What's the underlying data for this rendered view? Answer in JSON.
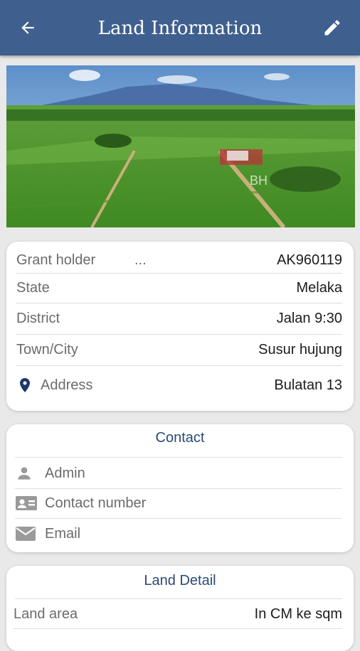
{
  "header": {
    "title": "Land Information",
    "back_icon": "arrow-left-icon",
    "edit_icon": "pencil-icon"
  },
  "hero_image": {
    "watermark": "BH"
  },
  "land_info": {
    "grant_holder_label": "Grant holder",
    "grant_holder_ellipsis": "...",
    "grant_holder_value": "AK960119",
    "state_label": "State",
    "state_value": "Melaka",
    "district_label": "District",
    "district_value": "Jalan 9:30",
    "town_label": "Town/City",
    "town_value": "Susur hujung",
    "address_label": "Address",
    "address_value": "Bulatan 13",
    "address_icon": "map-pin-icon"
  },
  "contact": {
    "title": "Contact",
    "admin_label": "Admin",
    "admin_icon": "person-icon",
    "contact_number_label": "Contact number",
    "contact_number_icon": "contact-card-icon",
    "email_label": "Email",
    "email_icon": "mail-icon"
  },
  "land_detail": {
    "title": "Land Detail",
    "land_area_label": "Land area",
    "land_area_value": "In CM ke sqm"
  },
  "colors": {
    "appbar": "#3f5f8e",
    "section_title": "#2a4a74",
    "background": "#e9e9e9"
  }
}
